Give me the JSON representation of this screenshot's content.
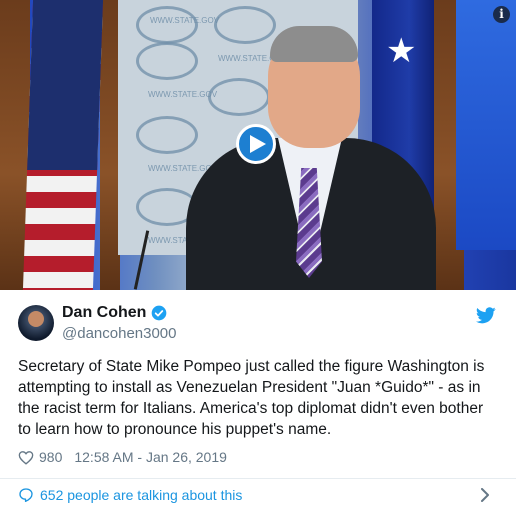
{
  "media": {
    "backdrop_text": "WWW.STATE.GOV",
    "info_label": "i"
  },
  "tweet": {
    "author_name": "Dan Cohen",
    "handle": "@dancohen3000",
    "text": "Secretary of State Mike Pompeo just called the figure Washington is attempting to install as Venezuelan President \"Juan *Guido*\" - as in the racist term for Italians. America's top diplomat didn't even bother to learn how to pronounce his puppet's name.",
    "likes": "980",
    "timestamp": "12:58 AM - Jan 26, 2019",
    "talking": "652 people are talking about this"
  },
  "colors": {
    "accent": "#1da1f2",
    "link": "#1b95e0",
    "muted": "#657786"
  },
  "icons": [
    "info-icon",
    "play-icon",
    "verified-badge-icon",
    "twitter-bird-icon",
    "heart-icon",
    "comment-bubble-icon",
    "chevron-right-icon"
  ]
}
